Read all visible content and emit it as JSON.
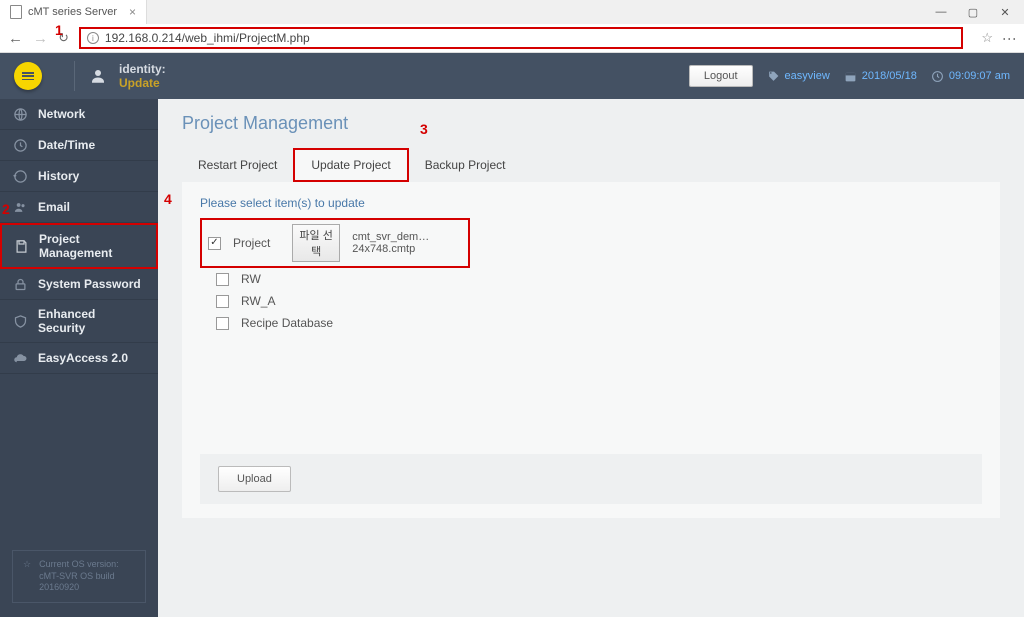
{
  "browser": {
    "tab_title": "cMT series Server",
    "url": "192.168.0.214/web_ihmi/ProjectM.php",
    "window_min": "—",
    "window_max": "▢",
    "window_close": "✕"
  },
  "annotations": {
    "a1": "1",
    "a2": "2",
    "a3": "3",
    "a4": "4"
  },
  "header": {
    "identity_label": "identity:",
    "identity_value": "Update",
    "logout": "Logout",
    "tag": "easyview",
    "date": "2018/05/18",
    "time": "09:09:07 am"
  },
  "sidebar": {
    "items": [
      {
        "label": "Network"
      },
      {
        "label": "Date/Time"
      },
      {
        "label": "History"
      },
      {
        "label": "Email"
      },
      {
        "label": "Project Management"
      },
      {
        "label": "System Password"
      },
      {
        "label": "Enhanced Security"
      },
      {
        "label": "EasyAccess 2.0"
      }
    ],
    "os_version_label": "Current OS version:",
    "os_version_value": "cMT-SVR OS build 20160920"
  },
  "main": {
    "title": "Project Management",
    "tabs": {
      "restart": "Restart Project",
      "update": "Update Project",
      "backup": "Backup Project"
    },
    "instruction": "Please select item(s) to update",
    "rows": {
      "project": {
        "label": "Project",
        "file_button": "파일 선택",
        "file_name": "cmt_svr_dem…24x748.cmtp"
      },
      "rw": {
        "label": "RW"
      },
      "rw_a": {
        "label": "RW_A"
      },
      "recipe": {
        "label": "Recipe Database"
      }
    },
    "upload": "Upload"
  }
}
